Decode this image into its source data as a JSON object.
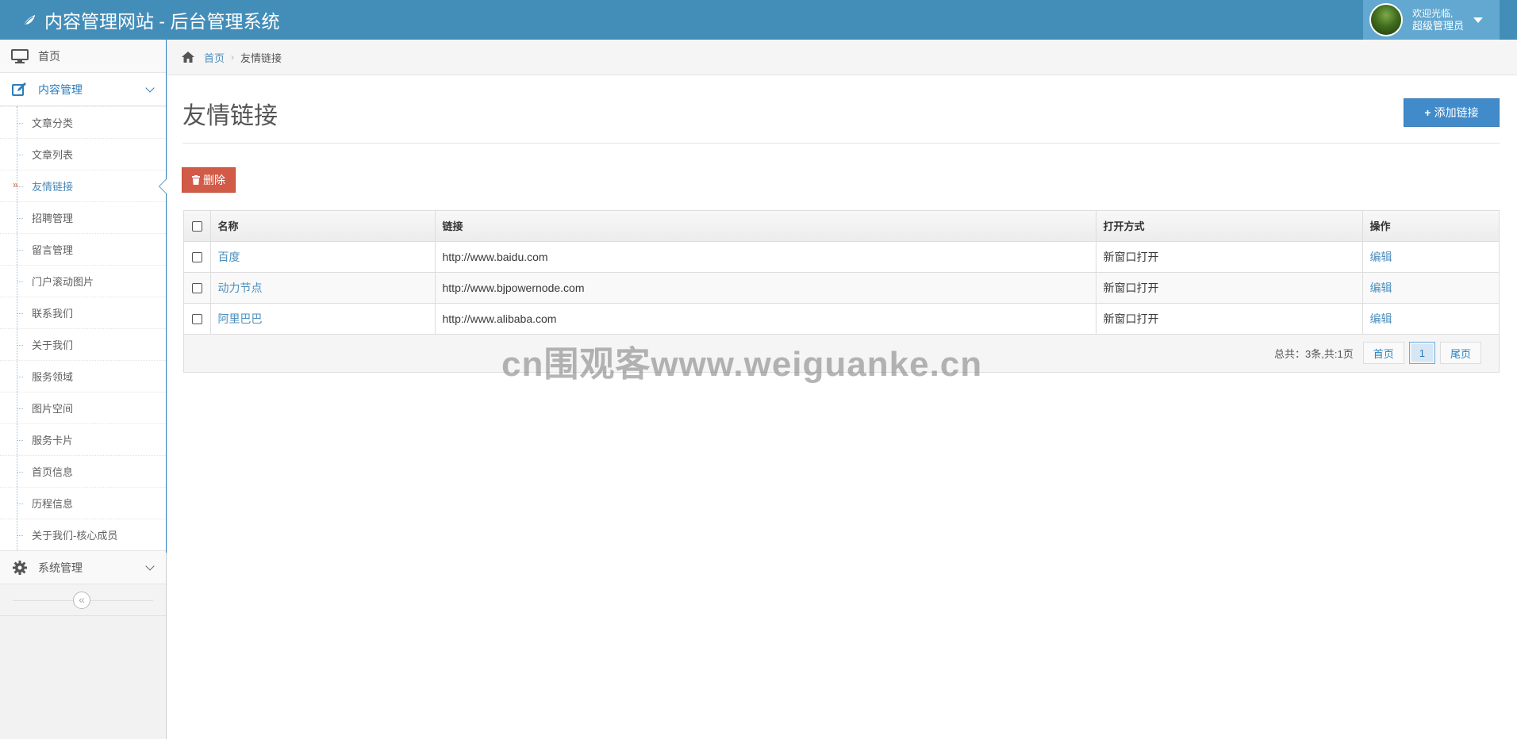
{
  "app": {
    "title": "内容管理网站 - 后台管理系统"
  },
  "user": {
    "greeting": "欢迎光临,",
    "name": "超级管理员"
  },
  "sidebar": {
    "home": "首页",
    "content_menu": "内容管理",
    "sub_items": [
      "文章分类",
      "文章列表",
      "友情链接",
      "招聘管理",
      "留言管理",
      "门户滚动图片",
      "联系我们",
      "关于我们",
      "服务领域",
      "图片空间",
      "服务卡片",
      "首页信息",
      "历程信息",
      "关于我们-核心成员"
    ],
    "active_sub": "友情链接",
    "system_menu": "系统管理",
    "collapse_glyph": "«"
  },
  "breadcrumb": {
    "home": "首页",
    "current": "友情链接"
  },
  "page": {
    "title": "友情链接",
    "add_button": "添加链接",
    "delete_button": "删除"
  },
  "table": {
    "headers": {
      "name": "名称",
      "link": "链接",
      "open_mode": "打开方式",
      "action": "操作"
    },
    "rows": [
      {
        "name": "百度",
        "link": "http://www.baidu.com",
        "open_mode": "新窗口打开",
        "action": "编辑"
      },
      {
        "name": "动力节点",
        "link": "http://www.bjpowernode.com",
        "open_mode": "新窗口打开",
        "action": "编辑"
      },
      {
        "name": "阿里巴巴",
        "link": "http://www.alibaba.com",
        "open_mode": "新窗口打开",
        "action": "编辑"
      }
    ]
  },
  "pagination": {
    "total": "总共：3条,共:1页",
    "first": "首页",
    "current": "1",
    "last": "尾页"
  },
  "watermark": "cn围观客www.weiguanke.cn",
  "colors": {
    "navbar": "#438eb9",
    "primary": "#428bca",
    "danger": "#d15b47",
    "link": "#4c8fbd"
  },
  "icons": {
    "brand": "leaf-icon",
    "home": "monitor-icon",
    "content": "edit-icon",
    "system": "gear-icon",
    "breadcrumb": "home-icon",
    "add": "plus-icon",
    "delete": "trash-icon"
  }
}
